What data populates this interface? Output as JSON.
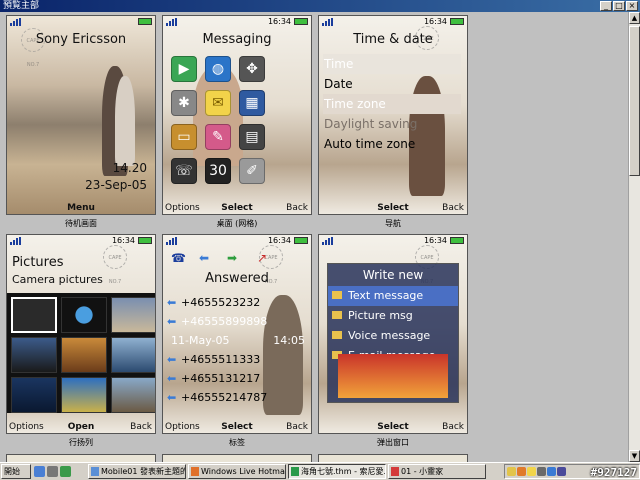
{
  "window": {
    "title": "預覧主部"
  },
  "status": {
    "time_icons": "16:34"
  },
  "cells": [
    {
      "caption": "待机画面",
      "title": "Sony Ericsson",
      "clock_time": "14.20",
      "clock_date": "23-Sep-05",
      "softkeys": {
        "left": "",
        "mid": "Menu",
        "right": ""
      }
    },
    {
      "caption": "桌面 (网格)",
      "title": "Messaging",
      "softkeys": {
        "left": "Options",
        "mid": "Select",
        "right": "Back"
      }
    },
    {
      "caption": "导航",
      "title": "Time & date",
      "items": [
        "Time",
        "Date",
        "Time zone",
        "Daylight saving",
        "Auto time zone"
      ],
      "softkeys": {
        "left": "",
        "mid": "Select",
        "right": "Back"
      }
    },
    {
      "caption": "行扬列",
      "title": "Pictures",
      "subtitle": "Camera pictures",
      "softkeys": {
        "left": "Options",
        "mid": "Open",
        "right": "Back"
      }
    },
    {
      "caption": "标签",
      "title": "Answered",
      "calls": [
        "+4655523232",
        "+46555899898",
        "+4655511333",
        "+4655131217",
        "+46555214787"
      ],
      "call_date": "11-May-05",
      "call_time": "14:05",
      "softkeys": {
        "left": "Options",
        "mid": "Select",
        "right": "Back"
      }
    },
    {
      "caption": "弹出窗口",
      "title": "Write new",
      "popup_items": [
        "Text message",
        "Picture msg",
        "Voice message",
        "E-mail message"
      ],
      "softkeys": {
        "left": "",
        "mid": "Select",
        "right": "Back"
      }
    }
  ],
  "stamp_text": "CAPE NO.7",
  "taskbar": {
    "start": "開始",
    "tasks": [
      "Mobile01 發表新主題的...",
      "Windows Live Hotmail -...",
      "海角七號.thm - 索尼愛...",
      "01 - 小靈家"
    ],
    "watermark": "#927127"
  }
}
